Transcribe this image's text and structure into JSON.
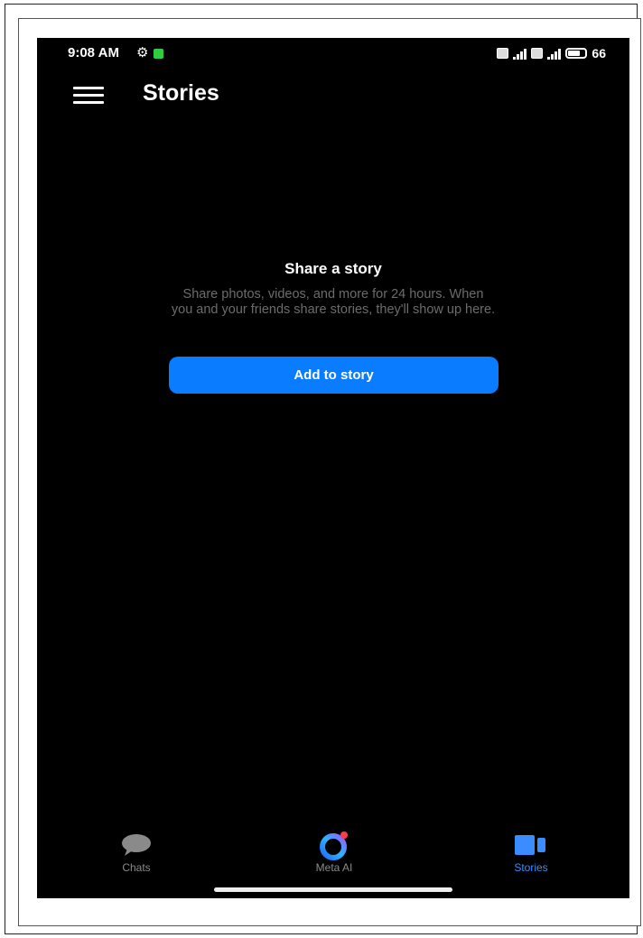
{
  "status_bar": {
    "time": "9:08 AM",
    "battery": "66"
  },
  "header": {
    "title": "Stories"
  },
  "empty_state": {
    "title": "Share a story",
    "description": "Share photos, videos, and more for 24 hours. When you and your friends share stories, they'll show up here.",
    "button_label": "Add to story"
  },
  "bottom_nav": {
    "items": [
      {
        "label": "Chats",
        "icon": "chat-bubble-icon",
        "active": false
      },
      {
        "label": "Meta AI",
        "icon": "meta-ai-ring-icon",
        "active": false
      },
      {
        "label": "Stories",
        "icon": "stories-icon",
        "active": true
      }
    ]
  },
  "colors": {
    "accent": "#0a7cff",
    "active_tab": "#3b8cff",
    "background": "#000000",
    "muted_text": "#6c6c6c"
  }
}
